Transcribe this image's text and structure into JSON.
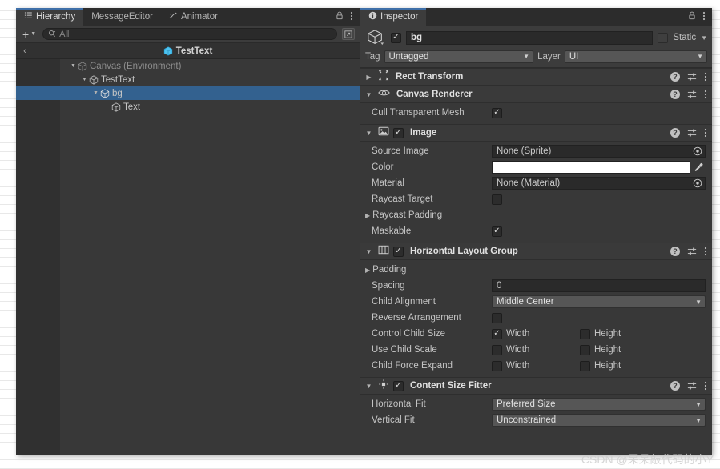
{
  "hierarchy": {
    "tabs": [
      {
        "label": "Hierarchy",
        "icon": "hierarchy-icon",
        "active": true
      },
      {
        "label": "MessageEditor",
        "icon": "",
        "active": false
      },
      {
        "label": "Animator",
        "icon": "animator-icon",
        "active": false
      }
    ],
    "lock_icon": "lock-icon",
    "menu_icon": "kebab-menu-icon",
    "toolbar": {
      "add_label": "+",
      "add_caret": "▼",
      "search_placeholder": "All",
      "search_value": "",
      "search_icon": "search-icon",
      "right_icon": "open-in-window-icon"
    },
    "breadcrumb": {
      "back_icon": "‹",
      "prefab_name": "TestText",
      "prefab_icon": "prefab-cube-icon"
    },
    "tree": [
      {
        "label": "Canvas (Environment)",
        "depth": 1,
        "arrow": "▼",
        "selected": false,
        "dim": true
      },
      {
        "label": "TestText",
        "depth": 2,
        "arrow": "▼",
        "selected": false,
        "dim": false
      },
      {
        "label": "bg",
        "depth": 3,
        "arrow": "▼",
        "selected": true,
        "dim": false
      },
      {
        "label": "Text",
        "depth": 4,
        "arrow": "",
        "selected": false,
        "dim": false
      }
    ]
  },
  "inspector": {
    "tab_label": "Inspector",
    "tab_icon": "info-icon",
    "lock_icon": "lock-icon",
    "menu_icon": "kebab-menu-icon",
    "game_object": {
      "icon": "gameobject-cube-icon",
      "enabled": true,
      "name": "bg",
      "static_label": "Static",
      "static_checked": false,
      "tag_label": "Tag",
      "tag_value": "Untagged",
      "layer_label": "Layer",
      "layer_value": "UI"
    },
    "help_icon": "help-icon",
    "preset_icon": "preset-sliders-icon",
    "context_icon": "kebab-menu-icon",
    "components": [
      {
        "name": "Rect Transform",
        "icon": "rect-transform-icon",
        "expanded": false,
        "has_enable_toggle": false,
        "foldout": "▶",
        "properties": []
      },
      {
        "name": "Canvas Renderer",
        "icon": "eye-icon",
        "expanded": true,
        "has_enable_toggle": false,
        "foldout": "▼",
        "properties": [
          {
            "type": "checkbox",
            "label": "Cull Transparent Mesh",
            "checked": true
          }
        ]
      },
      {
        "name": "Image",
        "icon": "image-icon",
        "expanded": true,
        "has_enable_toggle": true,
        "enabled": true,
        "foldout": "▼",
        "properties": [
          {
            "type": "object",
            "label": "Source Image",
            "value": "None (Sprite)"
          },
          {
            "type": "color",
            "label": "Color",
            "value": "#FFFFFF"
          },
          {
            "type": "object",
            "label": "Material",
            "value": "None (Material)"
          },
          {
            "type": "checkbox",
            "label": "Raycast Target",
            "checked": false
          },
          {
            "type": "foldout",
            "label": "Raycast Padding",
            "arrow": "▶"
          },
          {
            "type": "checkbox",
            "label": "Maskable",
            "checked": true
          }
        ]
      },
      {
        "name": "Horizontal Layout Group",
        "icon": "layout-group-icon",
        "expanded": true,
        "has_enable_toggle": true,
        "enabled": true,
        "foldout": "▼",
        "properties": [
          {
            "type": "foldout",
            "label": "Padding",
            "arrow": "▶"
          },
          {
            "type": "text",
            "label": "Spacing",
            "value": "0"
          },
          {
            "type": "dropdown",
            "label": "Child Alignment",
            "value": "Middle Center"
          },
          {
            "type": "checkbox",
            "label": "Reverse Arrangement",
            "checked": false
          },
          {
            "type": "double",
            "label": "Control Child Size",
            "a_label": "Width",
            "a_checked": true,
            "b_label": "Height",
            "b_checked": false
          },
          {
            "type": "double",
            "label": "Use Child Scale",
            "a_label": "Width",
            "a_checked": false,
            "b_label": "Height",
            "b_checked": false
          },
          {
            "type": "double",
            "label": "Child Force Expand",
            "a_label": "Width",
            "a_checked": false,
            "b_label": "Height",
            "b_checked": false
          }
        ]
      },
      {
        "name": "Content Size Fitter",
        "icon": "content-size-fitter-icon",
        "expanded": true,
        "has_enable_toggle": true,
        "enabled": true,
        "foldout": "▼",
        "properties": [
          {
            "type": "dropdown",
            "label": "Horizontal Fit",
            "value": "Preferred Size"
          },
          {
            "type": "dropdown",
            "label": "Vertical Fit",
            "value": "Unconstrained"
          }
        ]
      }
    ]
  },
  "watermark": "CSDN @呆呆敲代码的小Y",
  "colors": {
    "selection_blue": "#33618f",
    "active_tab_underline": "#3e6fa8",
    "panel_bg": "#383838",
    "header_bg": "#3a3a3a",
    "prefab_blue": "#4ec3ef"
  }
}
